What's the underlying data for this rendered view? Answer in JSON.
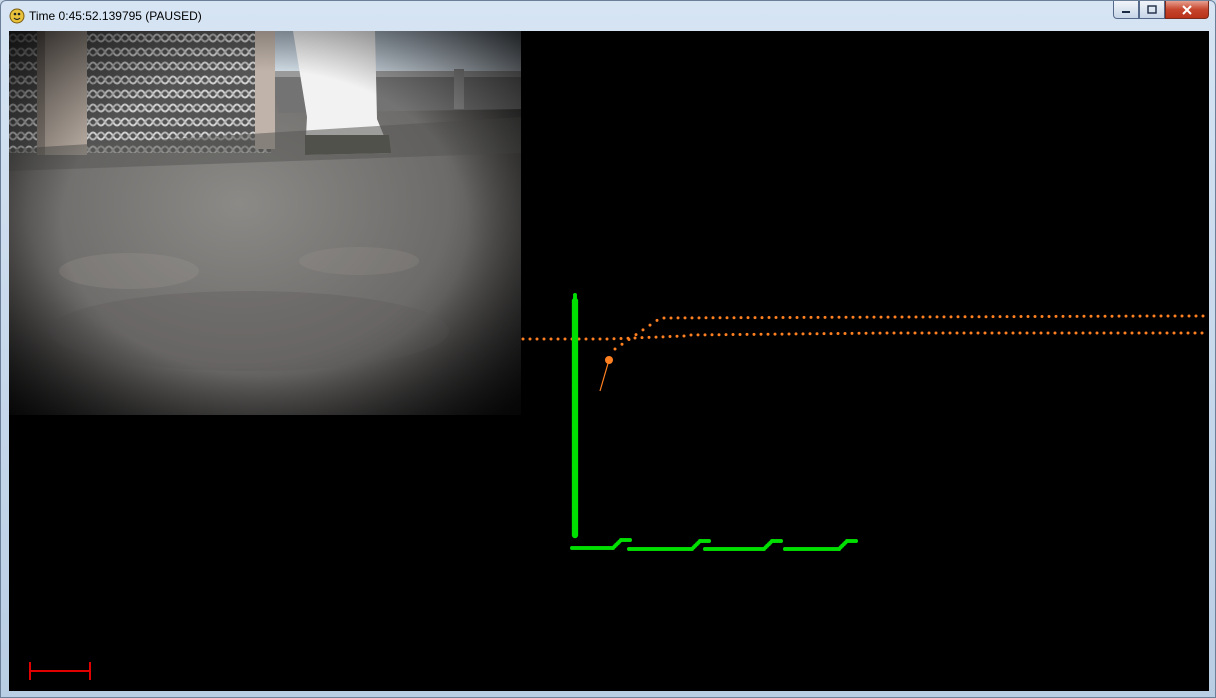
{
  "window": {
    "title": "Time 0:45:52.139795 (PAUSED)",
    "buttons": [
      "minimize",
      "maximize",
      "close"
    ],
    "icon": "python-snake-icon"
  },
  "viewport": {
    "background": "#000000",
    "camera_view": "simulated camera image of warehouse floor with lattice-panel wall and white pillar",
    "scan_color": "#00e000",
    "path_color": "#ff8020",
    "scale_bar_color": "#e00000"
  }
}
